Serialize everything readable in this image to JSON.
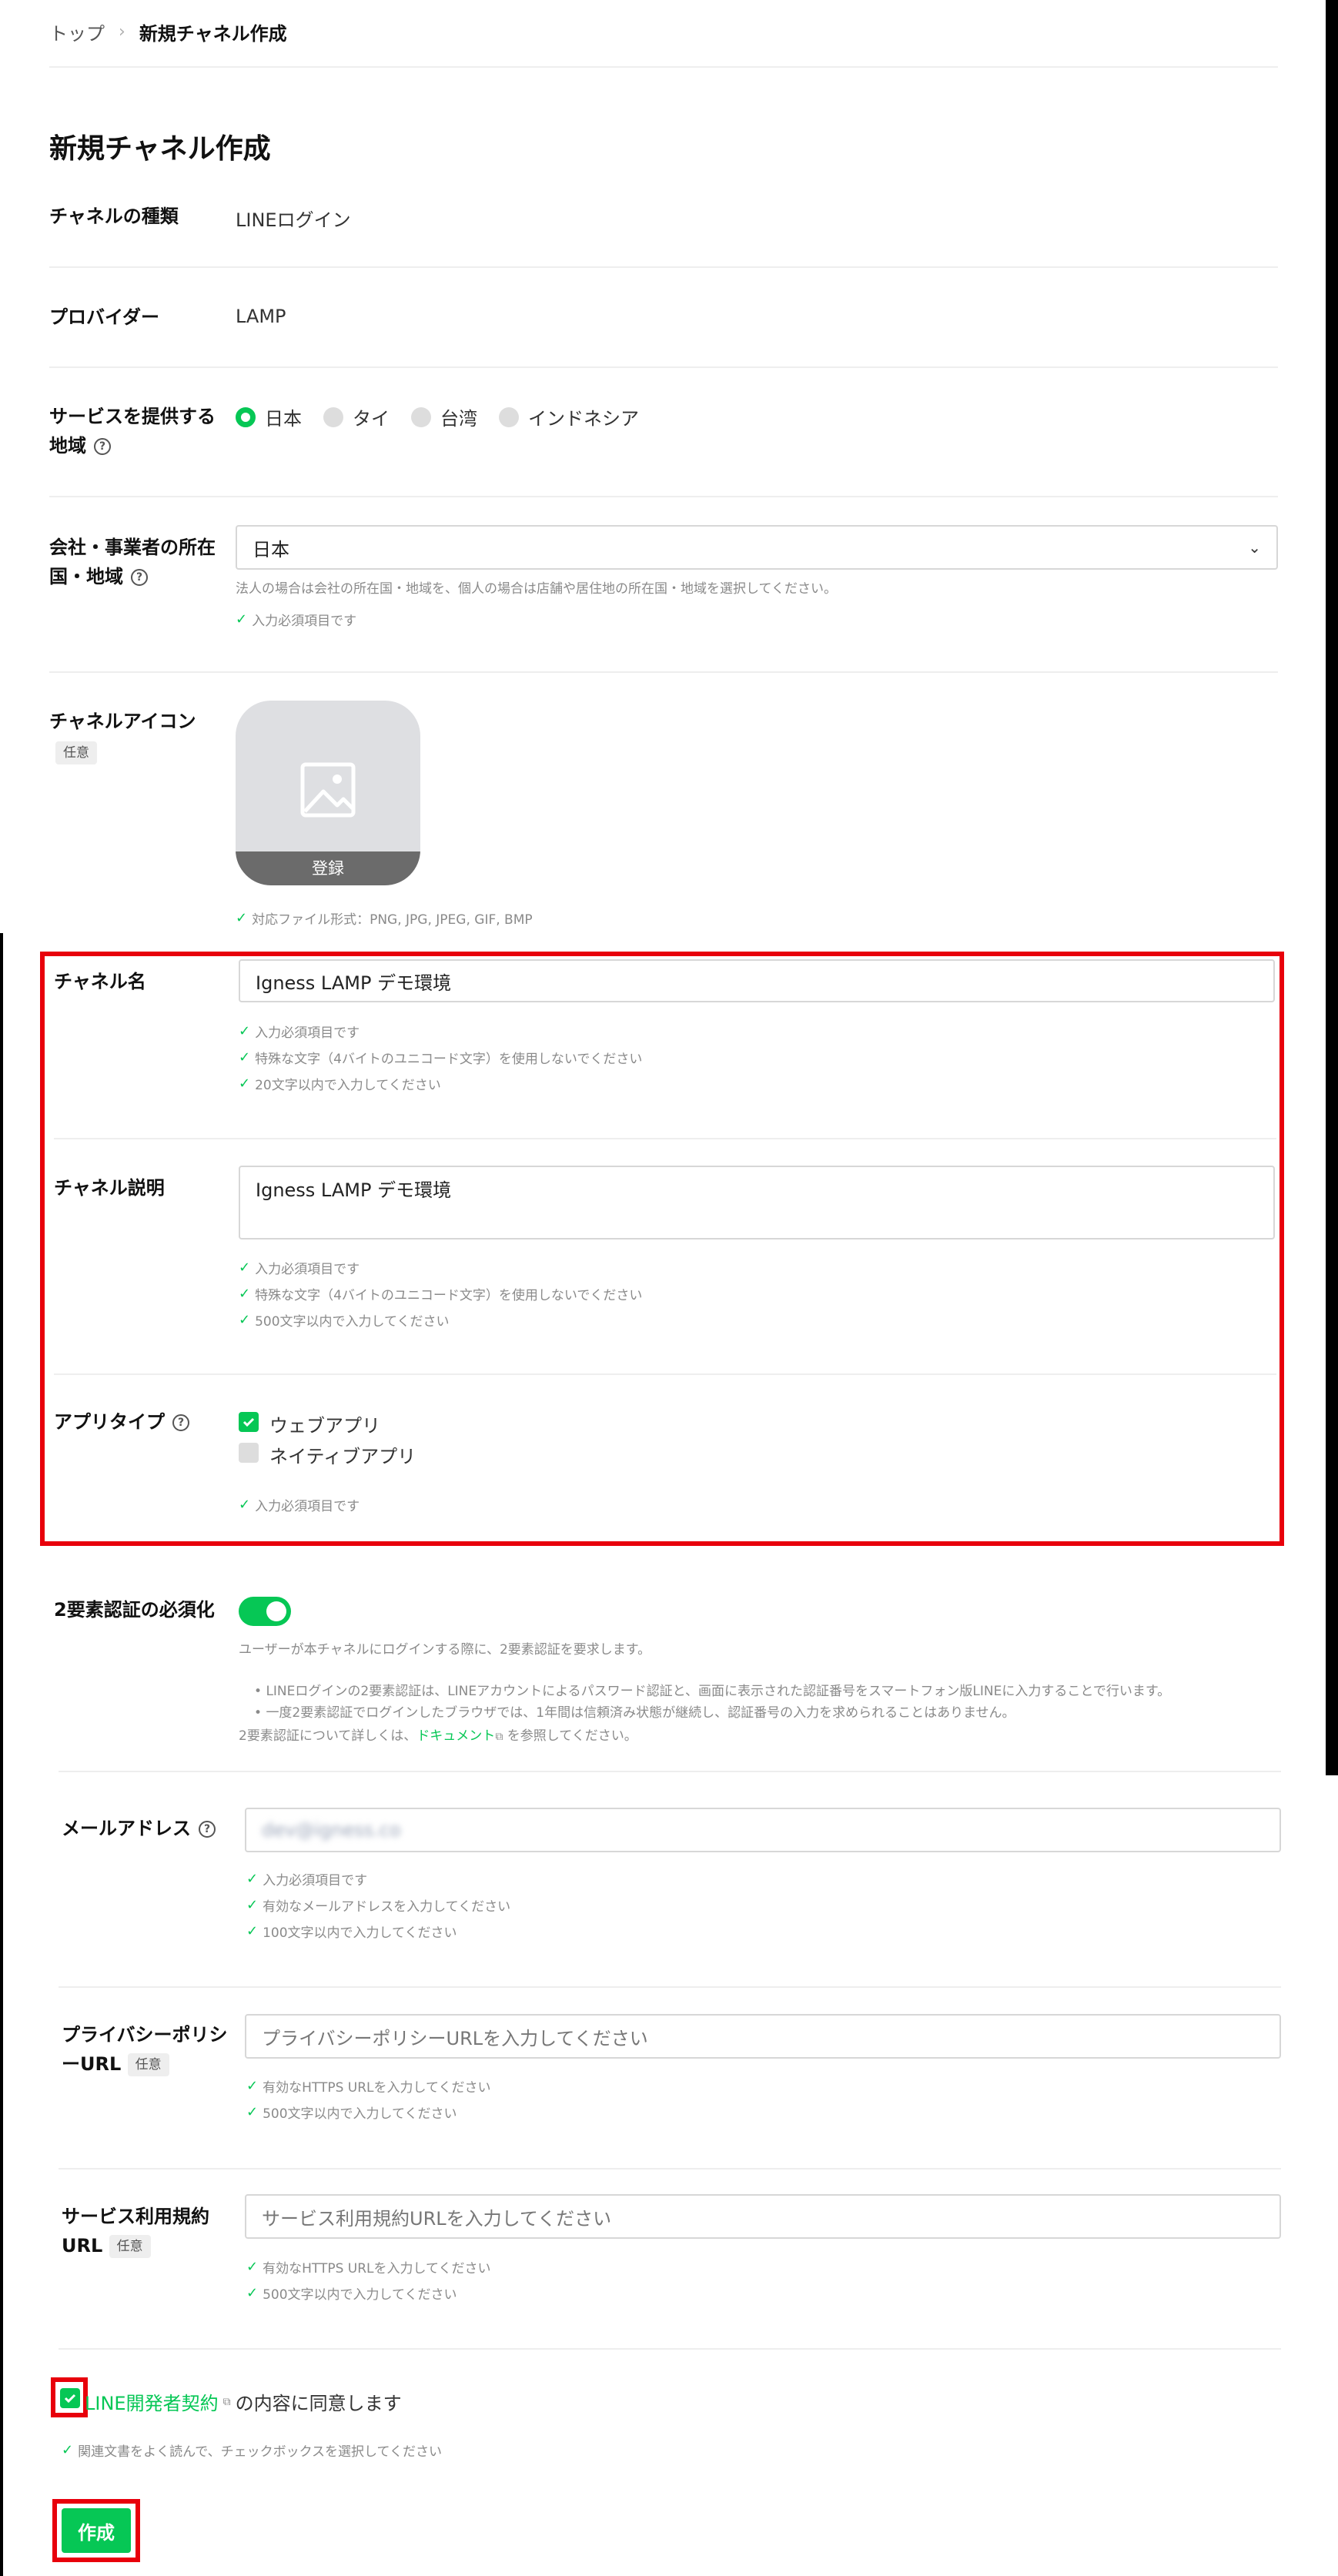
{
  "breadcrumb": {
    "home": "トップ",
    "separator": "›",
    "current": "新規チャネル作成"
  },
  "page_title": "新規チャネル作成",
  "channel_type": {
    "label": "チャネルの種類",
    "value": "LINEログイン"
  },
  "provider": {
    "label": "プロバイダー",
    "value": "LAMP"
  },
  "region": {
    "label_line1": "サービスを提供する",
    "label_line2": "地域",
    "options": [
      "日本",
      "タイ",
      "台湾",
      "インドネシア"
    ],
    "selected": "日本"
  },
  "company_country": {
    "label_line1": "会社・事業者の所在",
    "label_line2": "国・地域",
    "value": "日本",
    "hint": "法人の場合は会社の所在国・地域を、個人の場合は店舗や居住地の所在国・地域を選択してください。",
    "valid": "入力必須項目です"
  },
  "channel_icon": {
    "label": "チャネルアイコン",
    "optional": "任意",
    "register": "登録",
    "formats": "対応ファイル形式：PNG, JPG, JPEG, GIF, BMP"
  },
  "channel_name": {
    "label": "チャネル名",
    "value": "Igness LAMP デモ環境",
    "rules": [
      "入力必須項目です",
      "特殊な文字（4バイトのユニコード文字）を使用しないでください",
      "20文字以内で入力してください"
    ]
  },
  "channel_description": {
    "label": "チャネル説明",
    "value": "Igness LAMP デモ環境",
    "rules": [
      "入力必須項目です",
      "特殊な文字（4バイトのユニコード文字）を使用しないでください",
      "500文字以内で入力してください"
    ]
  },
  "app_type": {
    "label": "アプリタイプ",
    "options": [
      {
        "label": "ウェブアプリ",
        "checked": true
      },
      {
        "label": "ネイティブアプリ",
        "checked": false
      }
    ],
    "valid": "入力必須項目です"
  },
  "two_factor": {
    "label": "2要素認証の必須化",
    "enabled": true,
    "desc": "ユーザーが本チャネルにログインする際に、2要素認証を要求します。",
    "bullets": [
      "LINEログインの2要素認証は、LINEアカウントによるパスワード認証と、画面に表示された認証番号をスマートフォン版LINEに入力することで行います。",
      "一度2要素認証でログインしたブラウザでは、1年間は信頼済み状態が継続し、認証番号の入力を求められることはありません。"
    ],
    "doc_prefix": "2要素認証について詳しくは、",
    "doc_link": "ドキュメント",
    "doc_suffix": " を参照してください。"
  },
  "email": {
    "label": "メールアドレス",
    "value": "dev@igness.co",
    "rules": [
      "入力必須項目です",
      "有効なメールアドレスを入力してください",
      "100文字以内で入力してください"
    ]
  },
  "privacy": {
    "label_line1": "プライバシーポリシ",
    "label_line2": "ーURL",
    "optional": "任意",
    "placeholder": "プライバシーポリシーURLを入力してください",
    "rules": [
      "有効なHTTPS URLを入力してください",
      "500文字以内で入力してください"
    ]
  },
  "terms": {
    "label_line1": "サービス利用規約",
    "label_line2": "URL",
    "optional": "任意",
    "placeholder": "サービス利用規約URLを入力してください",
    "rules": [
      "有効なHTTPS URLを入力してください",
      "500文字以内で入力してください"
    ]
  },
  "agreement": {
    "link": "LINE開発者契約",
    "suffix": "の内容に同意します",
    "checked": true,
    "hint": "関連文書をよく読んで、チェックボックスを選択してください"
  },
  "create_button": "作成",
  "colors": {
    "accent": "#06c755",
    "highlight": "#e8000b",
    "text": "#111111",
    "muted": "#8a8a8a"
  }
}
